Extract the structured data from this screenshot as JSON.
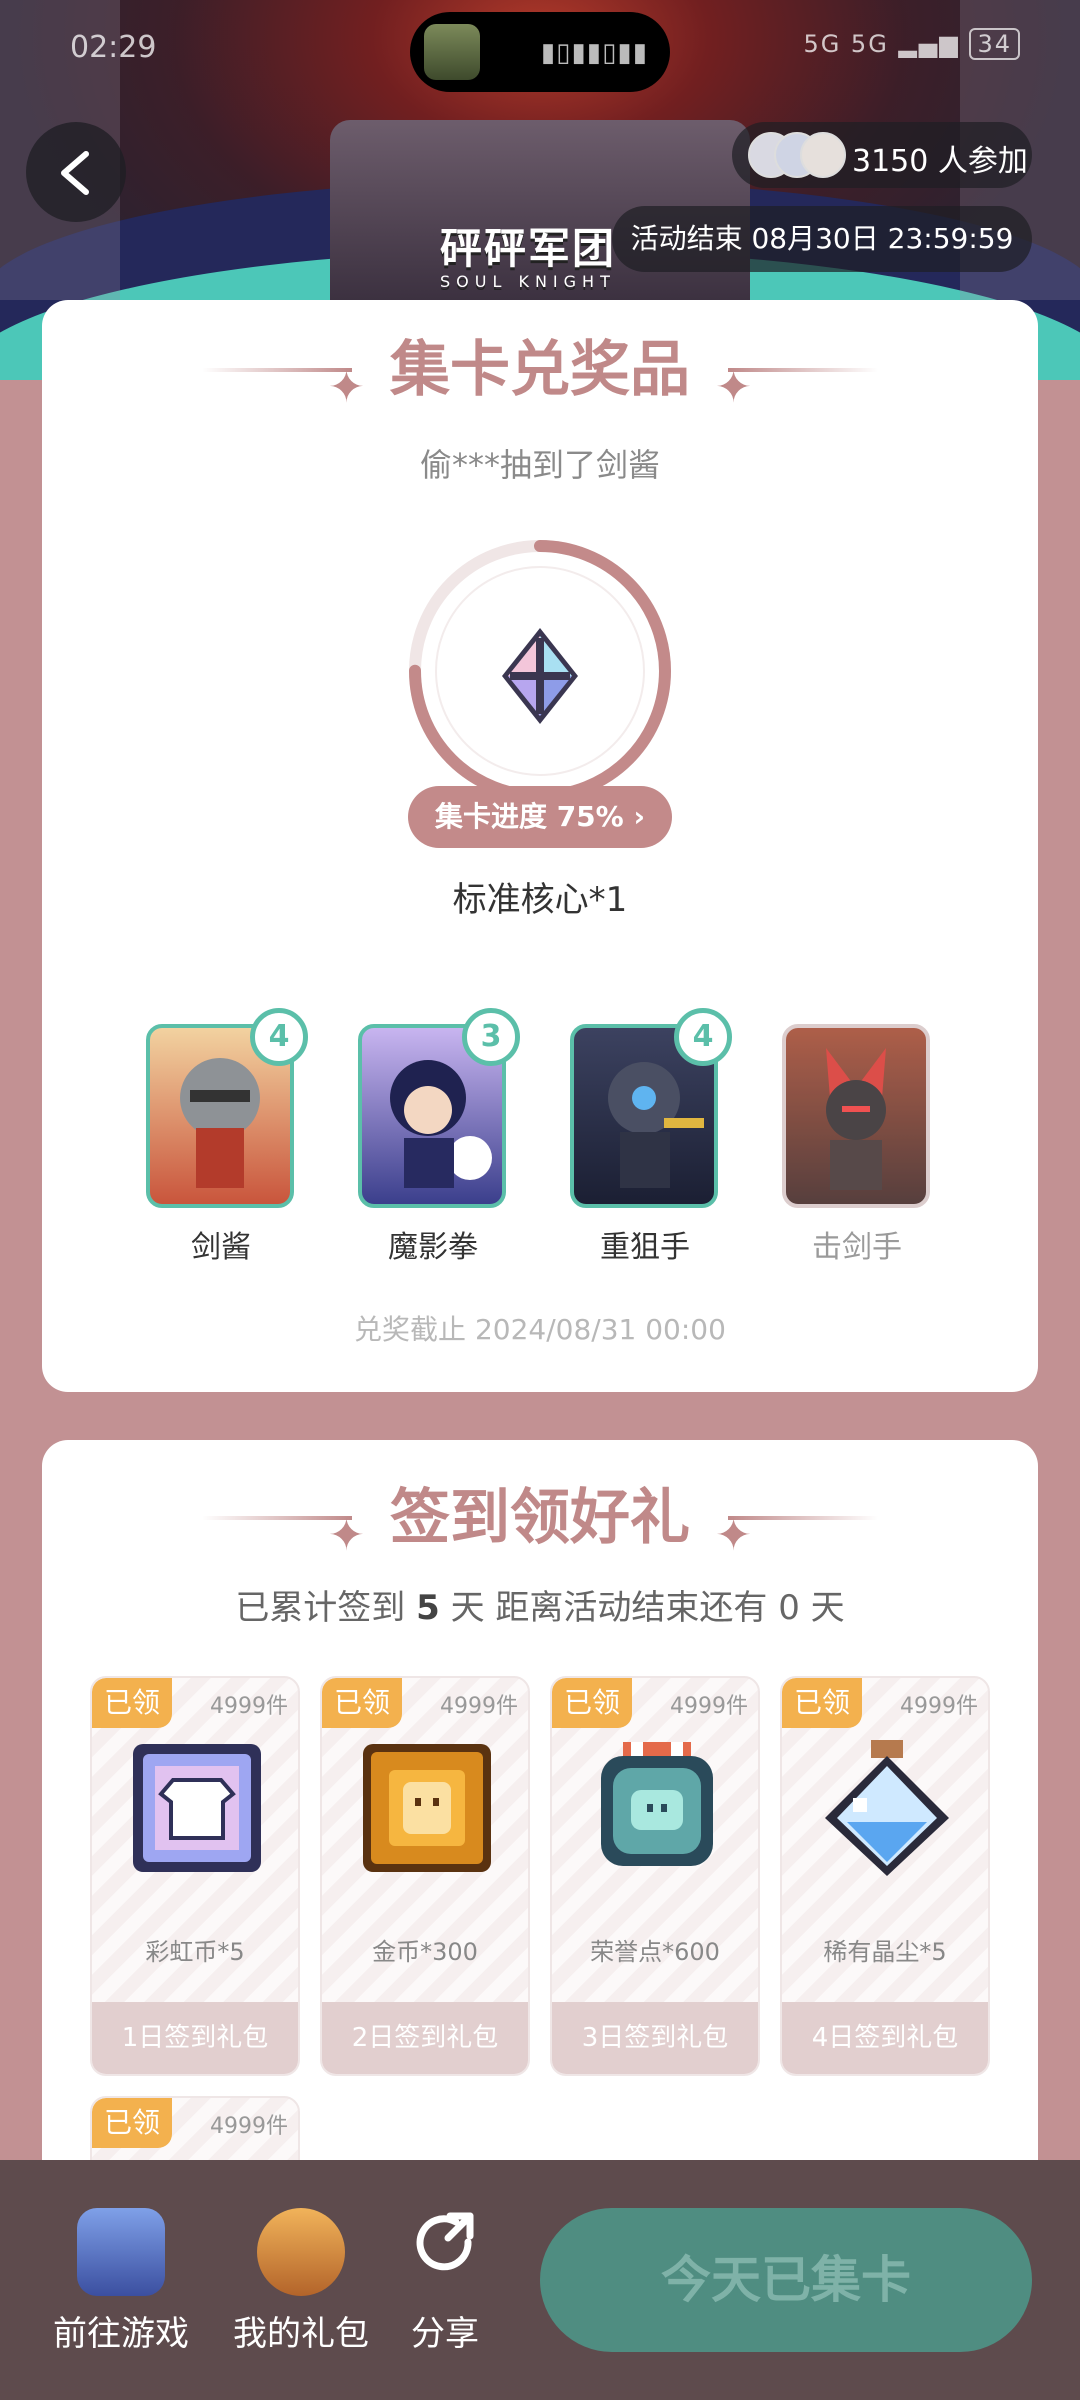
{
  "status_bar": {
    "time": "02:29",
    "network": "5G 5G",
    "battery": "34"
  },
  "header": {
    "participants": "3150 人参加",
    "end_time": "活动结束 08月30日 23:59:59",
    "logo_text": "砰砰军团",
    "logo_sub": "SOUL KNIGHT"
  },
  "prize_section": {
    "title": "集卡兑奖品",
    "ticker": "偷***抽到了剑酱",
    "progress_label": "集卡进度 75%",
    "progress_percent": 75,
    "prize_name": "标准核心*1",
    "cards": [
      {
        "name": "剑酱",
        "count": "4",
        "owned": true
      },
      {
        "name": "魔影拳",
        "count": "3",
        "owned": true
      },
      {
        "name": "重狙手",
        "count": "4",
        "owned": true
      },
      {
        "name": "击剑手",
        "count": "",
        "owned": false
      }
    ],
    "deadline": "兑奖截止 2024/08/31 00:00"
  },
  "signin_section": {
    "title": "签到领好礼",
    "summary_prefix": "已累计签到",
    "days": "5",
    "summary_mid": "天  距离活动结束还有 0 天",
    "gifts": [
      {
        "tag": "已领",
        "stock": "4999件",
        "name": "彩虹币*5",
        "label": "1日签到礼包",
        "icon": "rainbow-coin-icon"
      },
      {
        "tag": "已领",
        "stock": "4999件",
        "name": "金币*300",
        "label": "2日签到礼包",
        "icon": "gold-coin-icon"
      },
      {
        "tag": "已领",
        "stock": "4999件",
        "name": "荣誉点*600",
        "label": "3日签到礼包",
        "icon": "honor-point-icon"
      },
      {
        "tag": "已领",
        "stock": "4999件",
        "name": "稀有晶尘*5",
        "label": "4日签到礼包",
        "icon": "crystal-dust-icon"
      },
      {
        "tag": "已领",
        "stock": "4999件",
        "name": "",
        "label": "",
        "icon": ""
      }
    ]
  },
  "bottom_bar": {
    "go_game": "前往游戏",
    "my_gifts": "我的礼包",
    "share": "分享",
    "cta": "今天已集卡"
  },
  "colors": {
    "accent": "#c08989",
    "teal": "#5bbfa9",
    "tag": "#f3b14e",
    "cta": "#4f8d81"
  }
}
